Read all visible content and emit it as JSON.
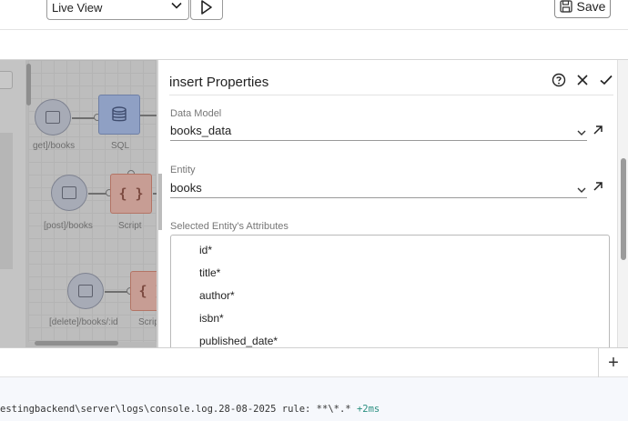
{
  "toolbar": {
    "view_select": "Live View",
    "run_icon": "play-icon",
    "save_label": "Save",
    "save_icon": "floppy-disk-icon"
  },
  "canvas": {
    "nodes": [
      {
        "label": "get]/books",
        "type": "endpoint"
      },
      {
        "label": "SQL",
        "type": "sql"
      },
      {
        "label": "[post]/books",
        "type": "endpoint"
      },
      {
        "label": "Script",
        "type": "script"
      },
      {
        "label": "[delete]/books/:id",
        "type": "endpoint"
      },
      {
        "label": "Scrip",
        "type": "script"
      }
    ],
    "script_glyph": "{ }",
    "script_glyph_partial": "{ }"
  },
  "panel": {
    "title": "insert Properties",
    "data_model_label": "Data Model",
    "data_model_value": "books_data",
    "entity_label": "Entity",
    "entity_value": "books",
    "attributes_label": "Selected Entity's Attributes",
    "attributes": [
      "id*",
      "title*",
      "author*",
      "isbn*",
      "published_date*"
    ]
  },
  "console": {
    "add_label": "+",
    "path": "estingbackend\\server\\logs\\console.log.28-08-2025 rule: **\\*.*",
    "elapsed": "+2ms"
  },
  "colors": {
    "sql_node": "#8fa0c4",
    "script_node": "#c79d94",
    "console_ms": "#2a8f80"
  }
}
